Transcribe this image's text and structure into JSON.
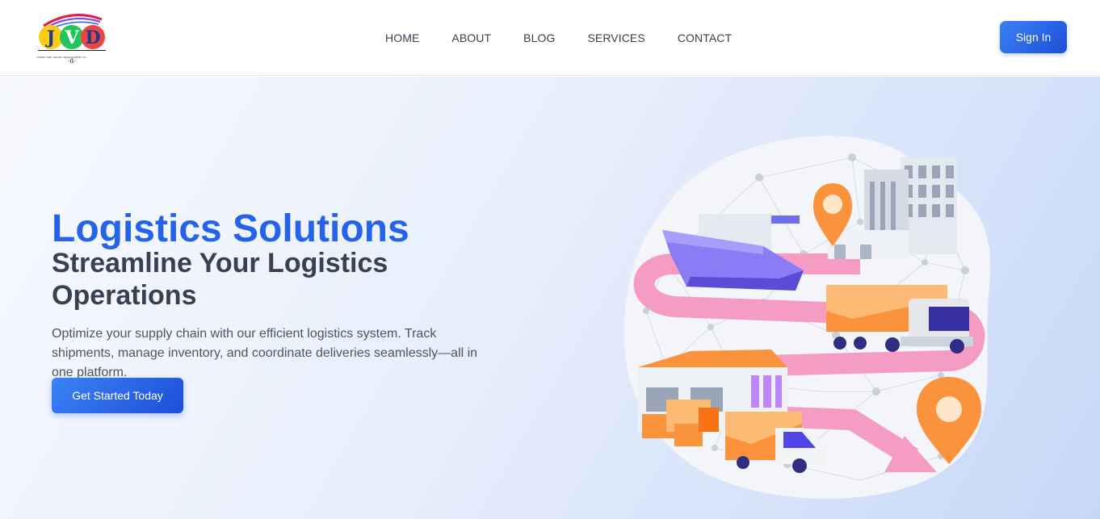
{
  "header": {
    "logo": {
      "letters": "JVD",
      "tagline": "EVENT AND TRAVEL MANAGEMENT CO"
    },
    "nav": [
      {
        "label": "HOME"
      },
      {
        "label": "ABOUT"
      },
      {
        "label": "BLOG"
      },
      {
        "label": "SERVICES"
      },
      {
        "label": "CONTACT"
      }
    ],
    "signin_label": "Sign In"
  },
  "hero": {
    "title": "Logistics Solutions",
    "subtitle": "Streamline Your Logistics Operations",
    "description": "Optimize your supply chain with our efficient logistics system. Track shipments, manage inventory, and coordinate deliveries seamlessly—all in one platform.",
    "cta_label": "Get Started Today"
  },
  "colors": {
    "accent": "#2563eb",
    "button_gradient_start": "#3b82f6",
    "button_gradient_end": "#1d4ed8",
    "heading_dark": "#374151",
    "route_pink": "#f472b6",
    "truck_orange": "#fb923c",
    "ship_purple": "#8b5cf6"
  },
  "icons": [
    "logo-icon",
    "map-pin-icon"
  ]
}
